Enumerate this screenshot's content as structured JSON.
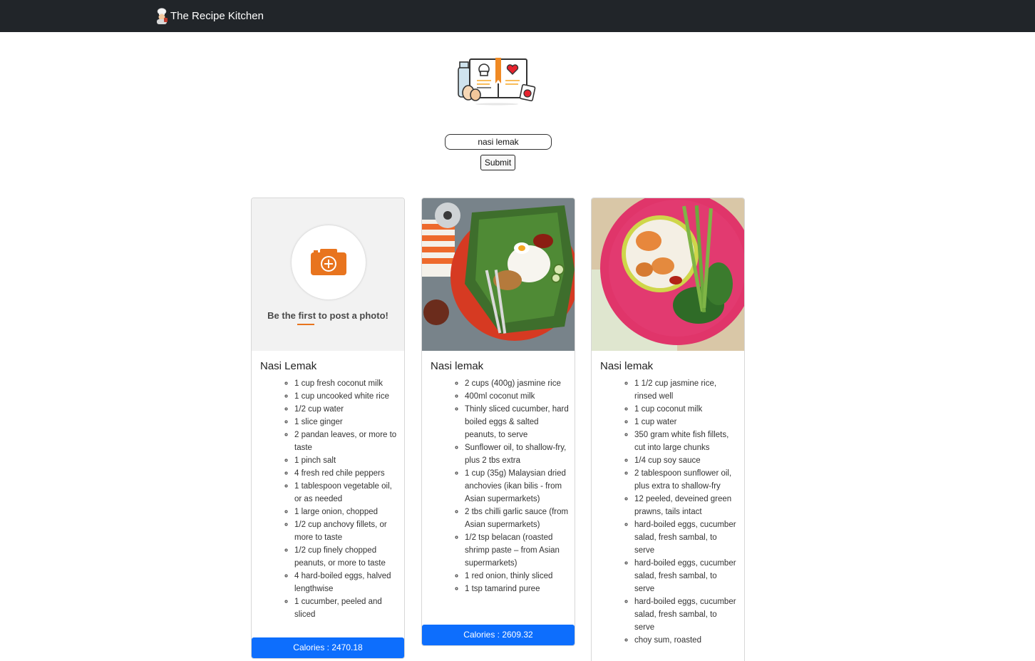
{
  "navbar": {
    "brand": "The Recipe Kitchen"
  },
  "search": {
    "value": "nasi lemak",
    "submit_label": "Submit"
  },
  "colors": {
    "navbar_bg": "#212529",
    "accent_blue": "#0d6efd",
    "camera_orange": "#e8741e"
  },
  "cards": [
    {
      "title": "Nasi Lemak",
      "image": "camera-placeholder",
      "placeholder_text": "Be the first to post a photo!",
      "ingredients": [
        "1 cup fresh coconut milk",
        "1 cup uncooked white rice",
        "1/2 cup water",
        "1 slice ginger",
        "2 pandan leaves, or more to taste",
        "1 pinch salt",
        "4 fresh red chile peppers",
        "1 tablespoon vegetable oil, or as needed",
        "1 large onion, chopped",
        "1/2 cup anchovy fillets, or more to taste",
        "1/2 cup finely chopped peanuts, or more to taste",
        "4 hard-boiled eggs, halved lengthwise",
        "1 cucumber, peeled and sliced"
      ],
      "calories_label": "Calories : 2470.18"
    },
    {
      "title": "Nasi lemak",
      "image": "nasi-lemak-banana-leaf-photo",
      "ingredients": [
        "2 cups (400g) jasmine rice",
        "400ml coconut milk",
        "Thinly sliced cucumber, hard boiled eggs & salted peanuts, to serve",
        "Sunflower oil, to shallow-fry, plus 2 tbs extra",
        "1 cup (35g) Malaysian dried anchovies (ikan bilis - from Asian supermarkets)",
        "2 tbs chilli garlic sauce (from Asian supermarkets)",
        "1/2 tsp belacan (roasted shrimp paste – from Asian supermarkets)",
        "1 red onion, thinly sliced",
        "1 tsp tamarind puree"
      ],
      "calories_label": "Calories : 2609.32"
    },
    {
      "title": "Nasi lemak",
      "image": "prawn-rice-bowl-photo",
      "ingredients": [
        "1 1/2 cup jasmine rice, rinsed well",
        "1 cup coconut milk",
        "1 cup water",
        "350 gram white fish fillets, cut into large chunks",
        "1/4 cup soy sauce",
        "2 tablespoon sunflower oil, plus extra to shallow-fry",
        "12 peeled, deveined green prawns, tails intact",
        "hard-boiled eggs, cucumber salad, fresh sambal, to serve",
        "hard-boiled eggs, cucumber salad, fresh sambal, to serve",
        "hard-boiled eggs, cucumber salad, fresh sambal, to serve",
        "choy sum, roasted"
      ]
    }
  ]
}
